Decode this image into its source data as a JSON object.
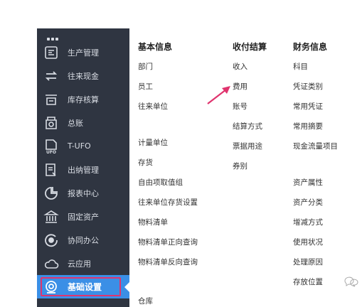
{
  "sidebar": {
    "items": [
      {
        "label": "生产管理",
        "icon": "production-icon"
      },
      {
        "label": "往来现金",
        "icon": "transfer-arrows-icon"
      },
      {
        "label": "库存核算",
        "icon": "inventory-icon"
      },
      {
        "label": "总账",
        "icon": "ledger-icon"
      },
      {
        "label": "T-UFO",
        "icon": "ufo-report-icon"
      },
      {
        "label": "出纳管理",
        "icon": "cashier-icon"
      },
      {
        "label": "报表中心",
        "icon": "pie-report-icon"
      },
      {
        "label": "固定资产",
        "icon": "bank-building-icon"
      },
      {
        "label": "协同办公",
        "icon": "collaboration-icon"
      },
      {
        "label": "云应用",
        "icon": "cloud-icon"
      },
      {
        "label": "基础设置",
        "icon": "settings-icon"
      }
    ],
    "active_index": 10,
    "active_color": "#3b8fe6",
    "highlight_color": "#e0346e"
  },
  "menu": {
    "columns": [
      {
        "heading": "基本信息",
        "items": [
          "部门",
          "员工",
          "往来单位",
          "计量单位",
          "存货",
          "自由项取值组",
          "往来单位存货设置",
          "物料清单",
          "物料清单正向查询",
          "物料清单反向查询",
          "仓库"
        ]
      },
      {
        "heading": "收付结算",
        "items": [
          "收入",
          "费用",
          "账号",
          "结算方式",
          "票据用途",
          "券别"
        ]
      },
      {
        "heading": "财务信息",
        "items": [
          "科目",
          "凭证类别",
          "常用凭证",
          "常用摘要",
          "现金流量项目",
          "资产属性",
          "资产分类",
          "增减方式",
          "使用状况",
          "处理原因",
          "存放位置"
        ]
      }
    ]
  },
  "annotation": {
    "arrow_color": "#e0346e",
    "arrow_target": "费用"
  }
}
